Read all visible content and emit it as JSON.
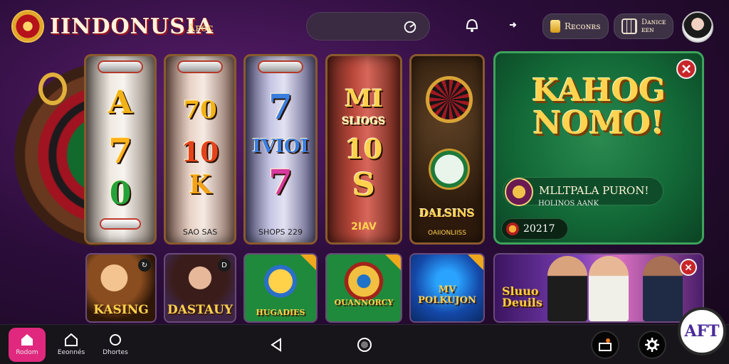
{
  "header": {
    "brand": "IINDONUSIA",
    "brand_sub": "Aᴘᴏᴄ",
    "search_placeholder": "",
    "buttons": {
      "rewards": "Rᴇᴄᴏɴʀs",
      "menu_line1": "Dᴀɴɪᴄᴇ",
      "menu_line2": "ᴇᴇɴ"
    }
  },
  "reels": [
    {
      "top": "A",
      "mid": "7",
      "bottom": "0",
      "footer": ""
    },
    {
      "top": "70",
      "mid": "10",
      "bottom": "K",
      "footer": "SAO SAS"
    },
    {
      "top": "7",
      "mid": "IVIOI",
      "bottom": "7",
      "footer": "SHOPS 229"
    },
    {
      "top": "MI",
      "sub": "SLIOGS",
      "mid": "10",
      "bottom": "S",
      "footer": "2IAV"
    },
    {
      "caption": "DALSINS",
      "footer": "OAIIONLIISS"
    }
  ],
  "promo": {
    "title_line1": "KAHOG",
    "title_line2": "NOMO!",
    "bar_title": "MLLTPALA PURON!",
    "subtitle": "HOLINOS AANK",
    "count": "20217"
  },
  "tiles": [
    {
      "label": "KASING",
      "badge": "↻"
    },
    {
      "label": "DASTAUY",
      "badge": "D"
    },
    {
      "label": "HUGADIES",
      "badge": ""
    },
    {
      "label": "OUANNORCY",
      "badge": ""
    },
    {
      "label": "MV POLKUJON",
      "badge": ""
    },
    {
      "label_line1": "Sluuo",
      "label_line2": "Deuils"
    }
  ],
  "nav": {
    "home": "Rodom",
    "second": "Eeonnés",
    "third": "Dhortes"
  },
  "aft_badge": "AFT",
  "colors": {
    "accent_pink": "#e0297e",
    "promo_green": "#136a38",
    "gold": "#ffd34e",
    "close_red": "#c9262a"
  }
}
